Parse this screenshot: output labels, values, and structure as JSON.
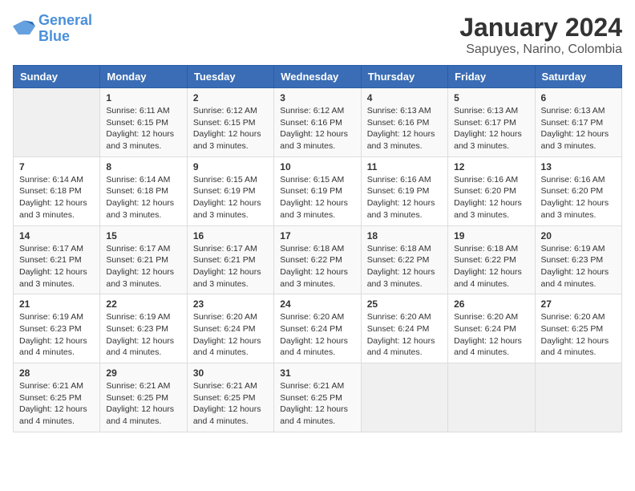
{
  "logo": {
    "line1": "General",
    "line2": "Blue"
  },
  "title": "January 2024",
  "subtitle": "Sapuyes, Narino, Colombia",
  "header": {
    "accent_color": "#3a6db5"
  },
  "weekdays": [
    "Sunday",
    "Monday",
    "Tuesday",
    "Wednesday",
    "Thursday",
    "Friday",
    "Saturday"
  ],
  "weeks": [
    [
      {
        "day": "",
        "empty": true
      },
      {
        "day": "1",
        "sunrise": "Sunrise: 6:11 AM",
        "sunset": "Sunset: 6:15 PM",
        "daylight": "Daylight: 12 hours and 3 minutes."
      },
      {
        "day": "2",
        "sunrise": "Sunrise: 6:12 AM",
        "sunset": "Sunset: 6:15 PM",
        "daylight": "Daylight: 12 hours and 3 minutes."
      },
      {
        "day": "3",
        "sunrise": "Sunrise: 6:12 AM",
        "sunset": "Sunset: 6:16 PM",
        "daylight": "Daylight: 12 hours and 3 minutes."
      },
      {
        "day": "4",
        "sunrise": "Sunrise: 6:13 AM",
        "sunset": "Sunset: 6:16 PM",
        "daylight": "Daylight: 12 hours and 3 minutes."
      },
      {
        "day": "5",
        "sunrise": "Sunrise: 6:13 AM",
        "sunset": "Sunset: 6:17 PM",
        "daylight": "Daylight: 12 hours and 3 minutes."
      },
      {
        "day": "6",
        "sunrise": "Sunrise: 6:13 AM",
        "sunset": "Sunset: 6:17 PM",
        "daylight": "Daylight: 12 hours and 3 minutes."
      }
    ],
    [
      {
        "day": "7",
        "sunrise": "Sunrise: 6:14 AM",
        "sunset": "Sunset: 6:18 PM",
        "daylight": "Daylight: 12 hours and 3 minutes."
      },
      {
        "day": "8",
        "sunrise": "Sunrise: 6:14 AM",
        "sunset": "Sunset: 6:18 PM",
        "daylight": "Daylight: 12 hours and 3 minutes."
      },
      {
        "day": "9",
        "sunrise": "Sunrise: 6:15 AM",
        "sunset": "Sunset: 6:19 PM",
        "daylight": "Daylight: 12 hours and 3 minutes."
      },
      {
        "day": "10",
        "sunrise": "Sunrise: 6:15 AM",
        "sunset": "Sunset: 6:19 PM",
        "daylight": "Daylight: 12 hours and 3 minutes."
      },
      {
        "day": "11",
        "sunrise": "Sunrise: 6:16 AM",
        "sunset": "Sunset: 6:19 PM",
        "daylight": "Daylight: 12 hours and 3 minutes."
      },
      {
        "day": "12",
        "sunrise": "Sunrise: 6:16 AM",
        "sunset": "Sunset: 6:20 PM",
        "daylight": "Daylight: 12 hours and 3 minutes."
      },
      {
        "day": "13",
        "sunrise": "Sunrise: 6:16 AM",
        "sunset": "Sunset: 6:20 PM",
        "daylight": "Daylight: 12 hours and 3 minutes."
      }
    ],
    [
      {
        "day": "14",
        "sunrise": "Sunrise: 6:17 AM",
        "sunset": "Sunset: 6:21 PM",
        "daylight": "Daylight: 12 hours and 3 minutes."
      },
      {
        "day": "15",
        "sunrise": "Sunrise: 6:17 AM",
        "sunset": "Sunset: 6:21 PM",
        "daylight": "Daylight: 12 hours and 3 minutes."
      },
      {
        "day": "16",
        "sunrise": "Sunrise: 6:17 AM",
        "sunset": "Sunset: 6:21 PM",
        "daylight": "Daylight: 12 hours and 3 minutes."
      },
      {
        "day": "17",
        "sunrise": "Sunrise: 6:18 AM",
        "sunset": "Sunset: 6:22 PM",
        "daylight": "Daylight: 12 hours and 3 minutes."
      },
      {
        "day": "18",
        "sunrise": "Sunrise: 6:18 AM",
        "sunset": "Sunset: 6:22 PM",
        "daylight": "Daylight: 12 hours and 3 minutes."
      },
      {
        "day": "19",
        "sunrise": "Sunrise: 6:18 AM",
        "sunset": "Sunset: 6:22 PM",
        "daylight": "Daylight: 12 hours and 4 minutes."
      },
      {
        "day": "20",
        "sunrise": "Sunrise: 6:19 AM",
        "sunset": "Sunset: 6:23 PM",
        "daylight": "Daylight: 12 hours and 4 minutes."
      }
    ],
    [
      {
        "day": "21",
        "sunrise": "Sunrise: 6:19 AM",
        "sunset": "Sunset: 6:23 PM",
        "daylight": "Daylight: 12 hours and 4 minutes."
      },
      {
        "day": "22",
        "sunrise": "Sunrise: 6:19 AM",
        "sunset": "Sunset: 6:23 PM",
        "daylight": "Daylight: 12 hours and 4 minutes."
      },
      {
        "day": "23",
        "sunrise": "Sunrise: 6:20 AM",
        "sunset": "Sunset: 6:24 PM",
        "daylight": "Daylight: 12 hours and 4 minutes."
      },
      {
        "day": "24",
        "sunrise": "Sunrise: 6:20 AM",
        "sunset": "Sunset: 6:24 PM",
        "daylight": "Daylight: 12 hours and 4 minutes."
      },
      {
        "day": "25",
        "sunrise": "Sunrise: 6:20 AM",
        "sunset": "Sunset: 6:24 PM",
        "daylight": "Daylight: 12 hours and 4 minutes."
      },
      {
        "day": "26",
        "sunrise": "Sunrise: 6:20 AM",
        "sunset": "Sunset: 6:24 PM",
        "daylight": "Daylight: 12 hours and 4 minutes."
      },
      {
        "day": "27",
        "sunrise": "Sunrise: 6:20 AM",
        "sunset": "Sunset: 6:25 PM",
        "daylight": "Daylight: 12 hours and 4 minutes."
      }
    ],
    [
      {
        "day": "28",
        "sunrise": "Sunrise: 6:21 AM",
        "sunset": "Sunset: 6:25 PM",
        "daylight": "Daylight: 12 hours and 4 minutes."
      },
      {
        "day": "29",
        "sunrise": "Sunrise: 6:21 AM",
        "sunset": "Sunset: 6:25 PM",
        "daylight": "Daylight: 12 hours and 4 minutes."
      },
      {
        "day": "30",
        "sunrise": "Sunrise: 6:21 AM",
        "sunset": "Sunset: 6:25 PM",
        "daylight": "Daylight: 12 hours and 4 minutes."
      },
      {
        "day": "31",
        "sunrise": "Sunrise: 6:21 AM",
        "sunset": "Sunset: 6:25 PM",
        "daylight": "Daylight: 12 hours and 4 minutes."
      },
      {
        "day": "",
        "empty": true
      },
      {
        "day": "",
        "empty": true
      },
      {
        "day": "",
        "empty": true
      }
    ]
  ]
}
